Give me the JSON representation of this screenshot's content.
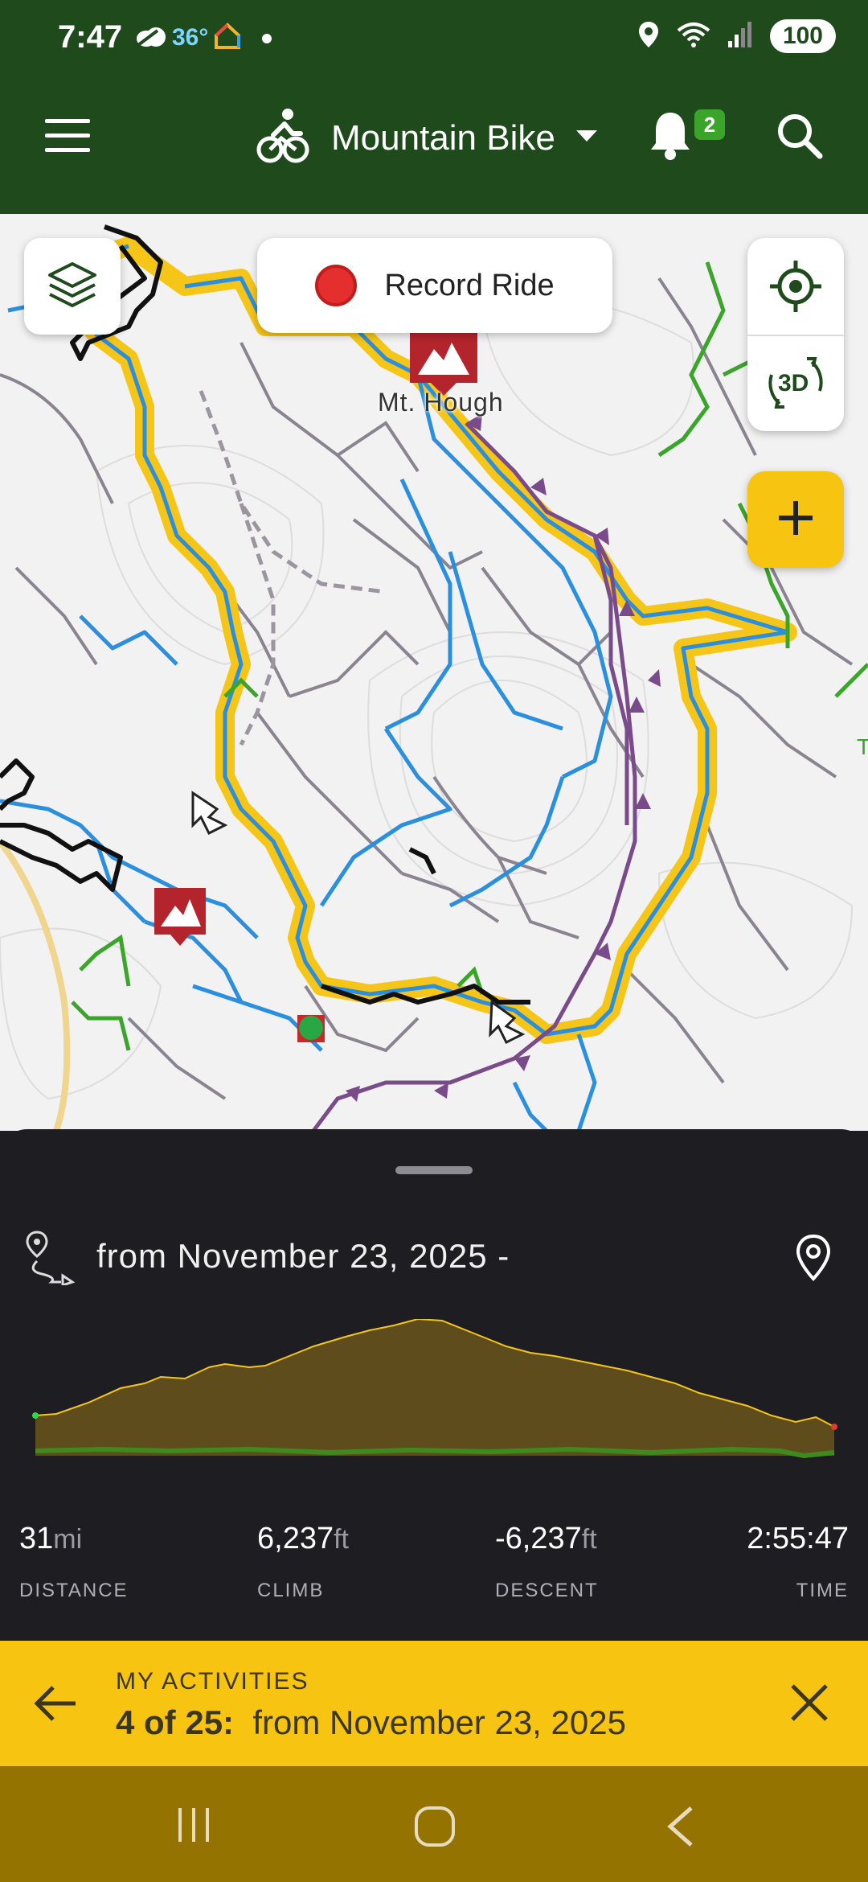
{
  "status_bar": {
    "time": "7:47",
    "temperature": "36°",
    "battery": "100",
    "icons": [
      "weather-icon",
      "home-app-icon",
      "dot-icon",
      "location-icon",
      "wifi-icon",
      "signal-icon",
      "battery-icon"
    ]
  },
  "app_bar": {
    "activity": "Mountain Bike",
    "notification_count": "2",
    "icons": [
      "menu-icon",
      "bike-icon",
      "dropdown-icon",
      "bell-icon",
      "search-icon"
    ]
  },
  "map": {
    "record_label": "Record Ride",
    "peak_label": "Mt. Hough",
    "three_d_label": "3D",
    "edge_label": "T",
    "colors": {
      "route_highlight": "#f5c518",
      "trail_blue": "#2b8fe0",
      "trail_purple": "#7a4b8a",
      "trail_green": "#3aa52a",
      "trail_gray": "#8a8390",
      "trail_black": "#111111",
      "peak_marker": "#b3242c"
    }
  },
  "sheet": {
    "route_title": "from November 23, 2025 -",
    "stats": [
      {
        "value": "31",
        "unit": "mi",
        "label": "DISTANCE"
      },
      {
        "value": "6,237",
        "unit": "ft",
        "label": "CLIMB"
      },
      {
        "value": "-6,237",
        "unit": "ft",
        "label": "DESCENT"
      },
      {
        "value": "2:55:47",
        "unit": "",
        "label": "TIME"
      }
    ],
    "profile_colors": {
      "fill": "#5e4c1c",
      "line": "#f5c518",
      "ground": "#3f8a1f"
    }
  },
  "banner": {
    "kicker": "MY ACTIVITIES",
    "count": "4 of 25:",
    "title": "from November 23, 2025"
  },
  "nav": {
    "icons": [
      "recents-icon",
      "home-icon",
      "back-icon"
    ]
  }
}
